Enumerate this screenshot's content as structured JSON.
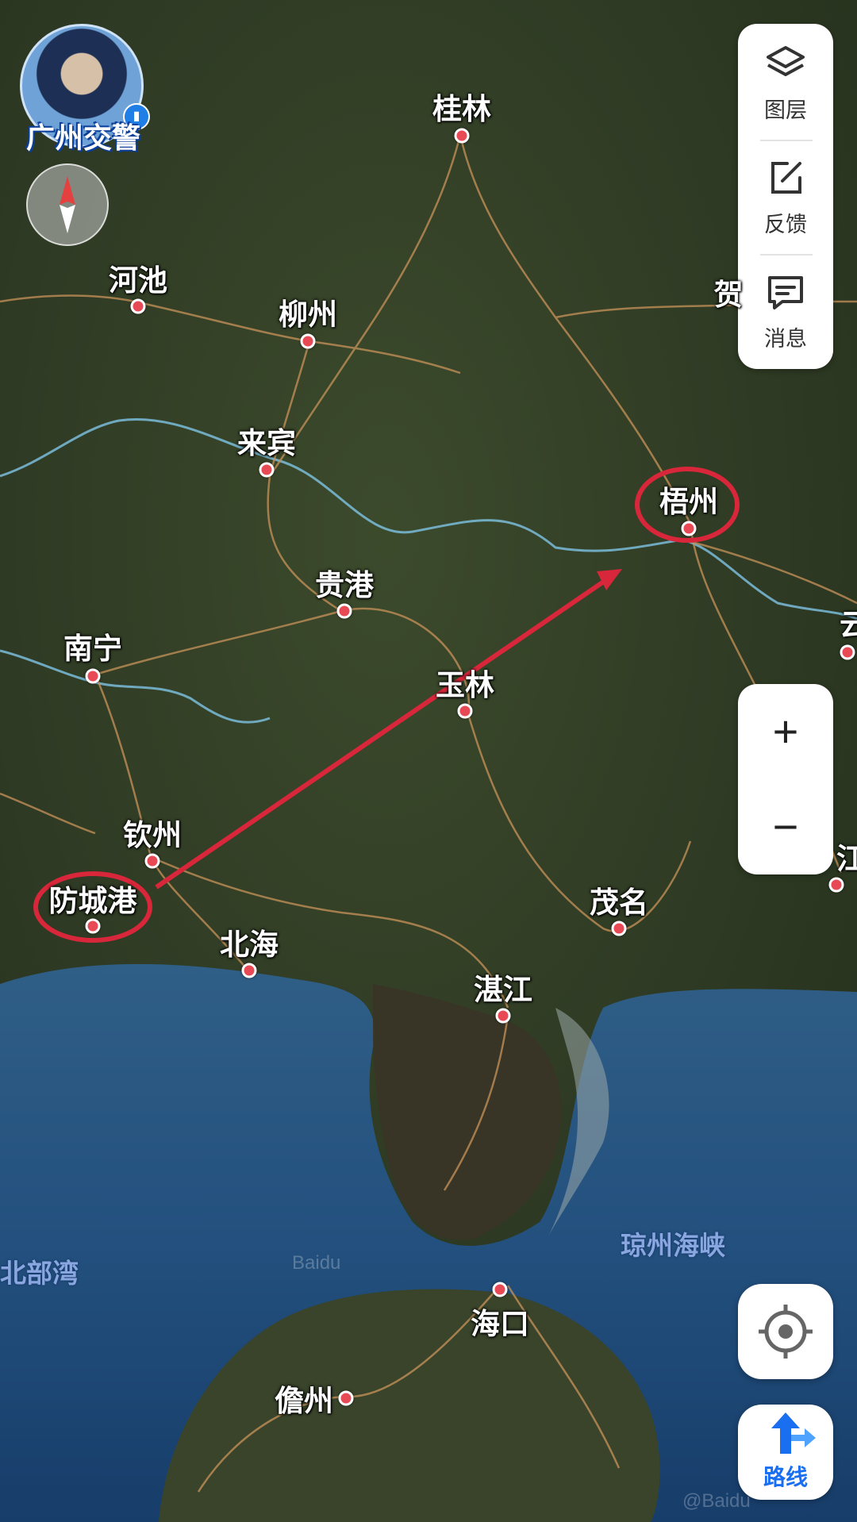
{
  "avatar": {
    "caption": "广州交警"
  },
  "compass": {
    "icon": "compass-icon"
  },
  "toolbar": {
    "layers_label": "图层",
    "feedback_label": "反馈",
    "messages_label": "消息"
  },
  "zoom": {
    "in_label": "+",
    "out_label": "−"
  },
  "locate": {
    "icon": "locate-icon"
  },
  "route": {
    "label": "路线"
  },
  "cities": {
    "guilin": "桂林",
    "hechi": "河池",
    "liuzhou": "柳州",
    "he": "贺",
    "laibin": "来宾",
    "wuzhou": "梧州",
    "guigang": "贵港",
    "yun": "云浮",
    "nanning": "南宁",
    "yulin": "玉林",
    "qinzhou": "钦州",
    "jiang": "江",
    "fangchenggang": "防城港",
    "maoming": "茂名",
    "beihai": "北海",
    "zhanjiang": "湛江",
    "haikou": "海口",
    "danzhou": "儋州"
  },
  "water": {
    "beibu": "北部湾",
    "qiongzhou": "琼州海峡"
  },
  "watermarks": {
    "baidu1": "Baidu",
    "baidu2": "@Baidu"
  },
  "colors": {
    "highlight": "#d8263a",
    "city_dot": "#e84a55",
    "route_blue": "#1a6ff0"
  }
}
